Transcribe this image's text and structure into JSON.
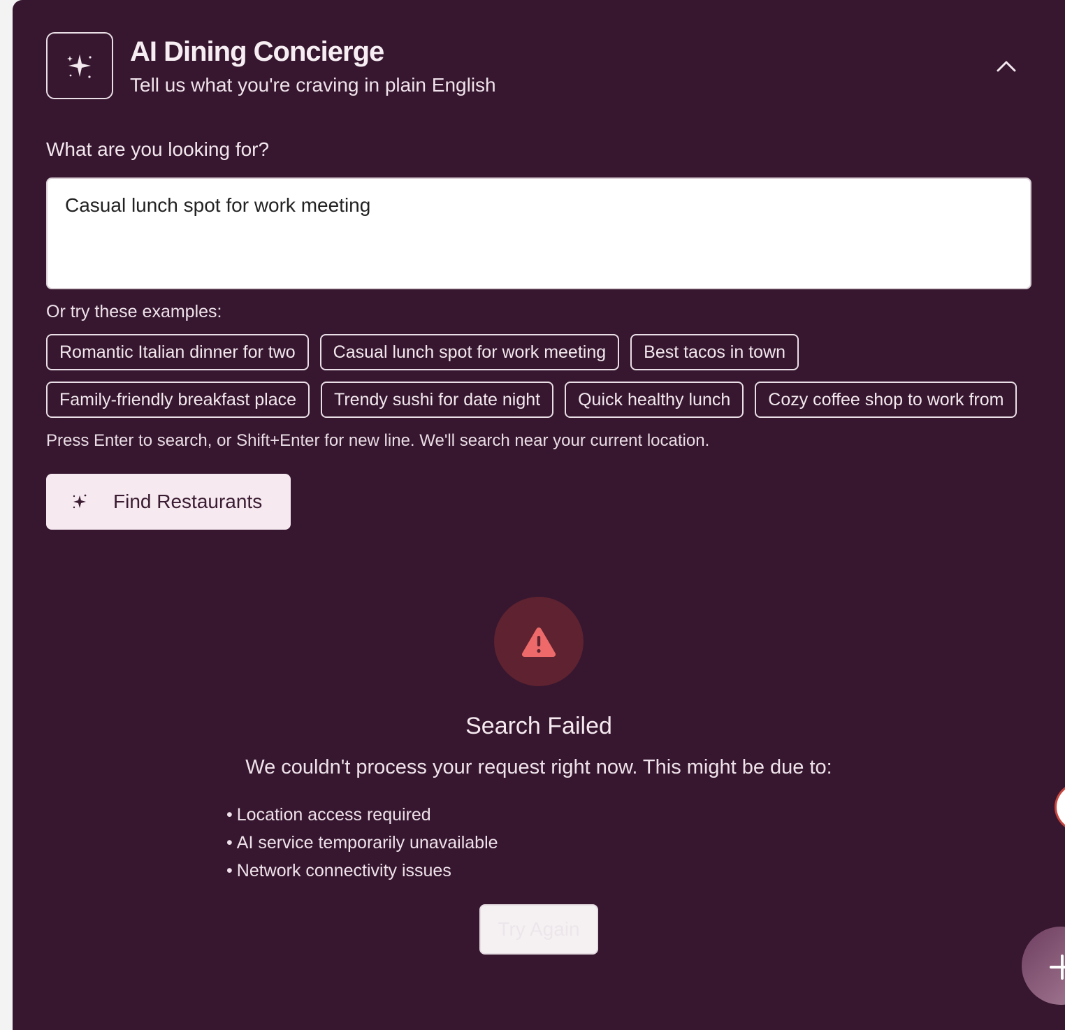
{
  "header": {
    "title": "AI Dining Concierge",
    "subtitle": "Tell us what you're craving in plain English"
  },
  "query": {
    "label": "What are you looking for?",
    "value": "Casual lunch spot for work meeting"
  },
  "examples": {
    "label": "Or try these examples:",
    "items": [
      "Romantic Italian dinner for two",
      "Casual lunch spot for work meeting",
      "Best tacos in town",
      "Family-friendly breakfast place",
      "Trendy sushi for date night",
      "Quick healthy lunch",
      "Cozy coffee shop to work from"
    ]
  },
  "hint": "Press Enter to search, or Shift+Enter for new line. We'll search near your current location.",
  "find_button": {
    "label": "Find Restaurants",
    "icon": "sparkles-icon"
  },
  "error": {
    "icon": "warning-triangle-icon",
    "title": "Search Failed",
    "description": "We couldn't process your request right now. This might be due to:",
    "reasons": [
      "Location access required",
      "AI service temporarily unavailable",
      "Network connectivity issues"
    ],
    "retry_label": "Try Again"
  },
  "colors": {
    "panel_bg": "#36172f",
    "error_circle": "#5e2230",
    "warning": "#ee6a6a",
    "button_bg": "#f6eaf0"
  }
}
